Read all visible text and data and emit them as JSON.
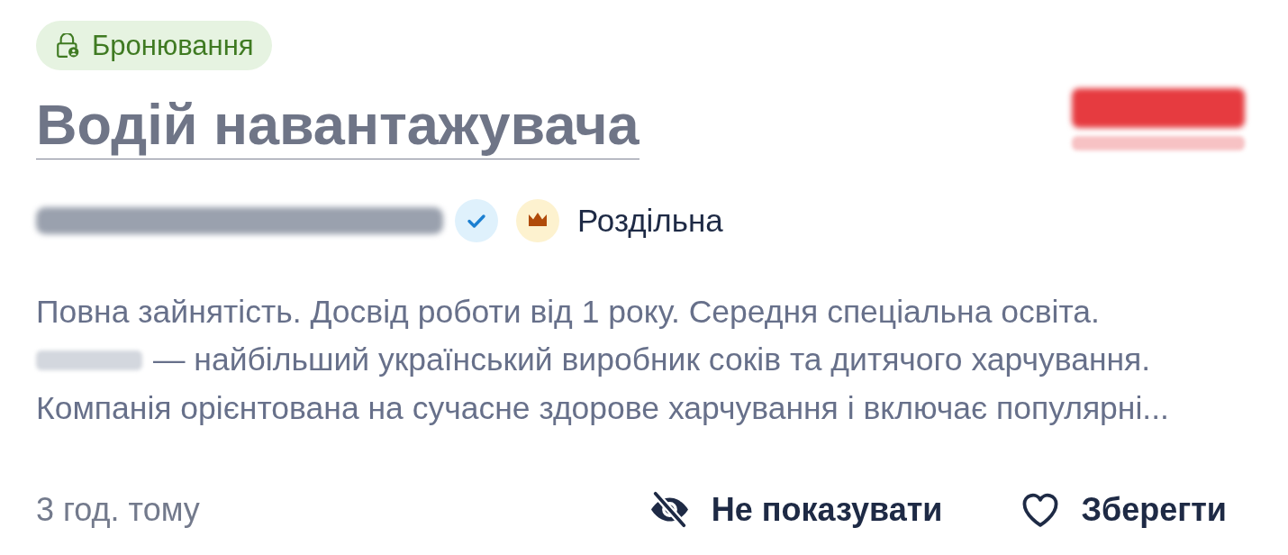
{
  "tag": {
    "label": "Бронювання"
  },
  "title": "Водій навантажувача",
  "logo": {
    "kind": "blurred"
  },
  "company": {
    "name": {
      "kind": "blurred"
    },
    "verified": true,
    "premium": true
  },
  "location": "Роздільна",
  "description": [
    [
      {
        "kind": "text",
        "text": "Повна зайнятість. Досвід роботи від 1 року. Середня спеціальна освіта."
      }
    ],
    [
      {
        "kind": "blurred"
      },
      {
        "kind": "text",
        "text": "— найбільший український виробник соків та дитячого харчування."
      }
    ],
    [
      {
        "kind": "text",
        "text": "Компанія орієнтована на сучасне здорове харчування і включає популярні..."
      }
    ]
  ],
  "posted": "3 год. тому",
  "actions": [
    {
      "kind": "hide",
      "label": "Не показувати"
    },
    {
      "kind": "save",
      "label": "Зберегти"
    }
  ]
}
